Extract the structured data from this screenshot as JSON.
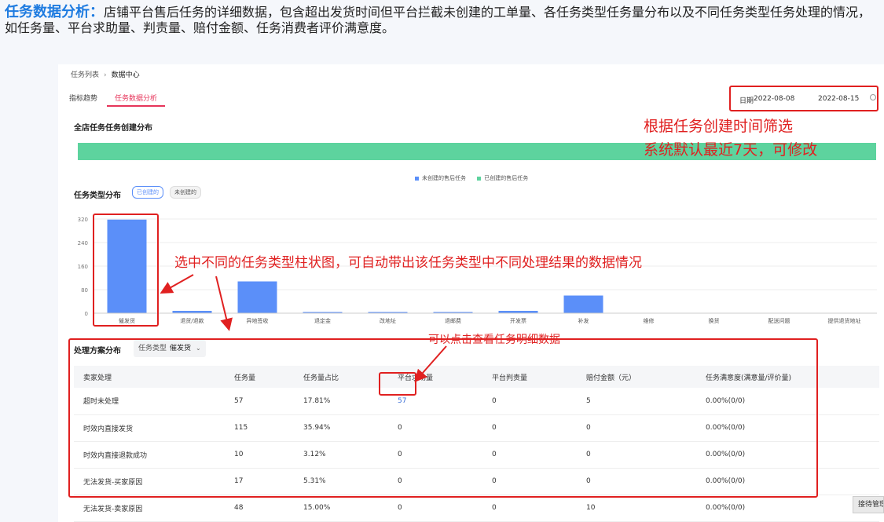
{
  "header": {
    "title": "任务数据分析：",
    "desc": "店铺平台售后任务的详细数据，包含超出发货时间但平台拦截未创建的工单量、各任务类型任务量分布以及不同任务类型任务处理的情况，如任务量、平台求助量、判责量、赔付金额、任务消费者评价满意度。"
  },
  "breadcrumb": {
    "root": "任务列表",
    "sep": "›",
    "current": "数据中心"
  },
  "tabs": [
    "指标趋势",
    "任务数据分析"
  ],
  "date_filter": {
    "label": "日期",
    "start": "2022-08-08",
    "end": "2022-08-15"
  },
  "create_dist": {
    "title": "全店任务任务创建分布"
  },
  "legend": {
    "uncreated": "未创建的售后任务",
    "created": "已创建的售后任务",
    "uncreated_color": "#5b8ff9",
    "created_color": "#5dd39e"
  },
  "type_dist": {
    "title": "任务类型分布",
    "toggle_created": "已创建的",
    "toggle_uncreated": "未创建的"
  },
  "chart_data": {
    "type": "bar",
    "categories": [
      "催发货",
      "退货/退款",
      "异地签收",
      "退定金",
      "改地址",
      "退邮费",
      "开发票",
      "补发",
      "维修",
      "换货",
      "配送问题",
      "提供退货地址"
    ],
    "values": [
      318,
      8,
      108,
      2,
      1,
      1,
      8,
      60,
      0,
      0,
      0,
      0
    ],
    "ylim": [
      0,
      320
    ],
    "yticks": [
      0,
      80,
      160,
      240,
      320
    ],
    "bar_color": "#5b8ff9"
  },
  "plan": {
    "title": "处理方案分布",
    "select_label": "任务类型",
    "select_value": "催发货"
  },
  "table": {
    "columns": [
      "卖家处理",
      "任务量",
      "任务量占比",
      "平台求助量",
      "平台判责量",
      "赔付金额（元）",
      "任务满意度(满意量/评价量)"
    ],
    "rows": [
      [
        "超时未处理",
        "57",
        "17.81%",
        "57",
        "0",
        "5",
        "0.00%(0/0)"
      ],
      [
        "时效内直接发货",
        "115",
        "35.94%",
        "0",
        "0",
        "0",
        "0.00%(0/0)"
      ],
      [
        "时效内直接退款成功",
        "10",
        "3.12%",
        "0",
        "0",
        "0",
        "0.00%(0/0)"
      ],
      [
        "无法发货-买家原因",
        "17",
        "5.31%",
        "0",
        "0",
        "0",
        "0.00%(0/0)"
      ],
      [
        "无法发货-卖家原因",
        "48",
        "15.00%",
        "0",
        "0",
        "10",
        "0.00%(0/0)"
      ]
    ]
  },
  "annotations": {
    "date_note_1": "根据任务创建时间筛选",
    "date_note_2": "系统默认最近7天，可修改",
    "bar_note": "选中不同的任务类型柱状图，可自动带出该任务类型中不同处理结果的数据情况",
    "detail_note": "可以点击查看任务明细数据"
  },
  "side_button": "接待管理"
}
